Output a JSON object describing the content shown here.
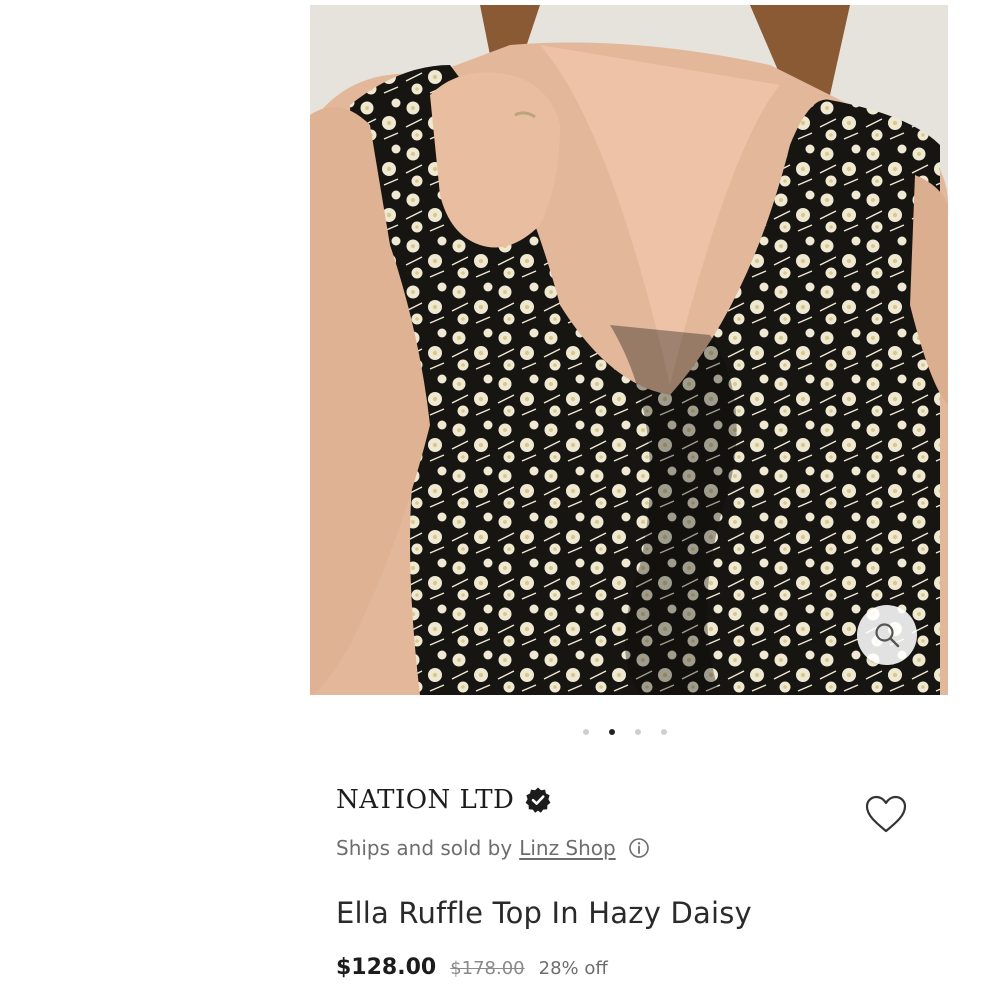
{
  "product": {
    "image_alt": "Ella Ruffle Top In Hazy Daisy",
    "carousel": {
      "total": 4,
      "active": 2
    },
    "brand": "NATION LTD",
    "seller_prefix": "Ships and sold by",
    "seller_name": "Linz Shop",
    "title": "Ella Ruffle Top In Hazy Daisy",
    "price": "$128.00",
    "original_price": "$178.00",
    "discount": "28% off"
  },
  "icons": {
    "zoom": "magnifier-icon",
    "verified": "verified-badge-icon",
    "favorite": "heart-icon",
    "info": "info-icon"
  },
  "colors": {
    "text_primary": "#1c1c1c",
    "text_secondary": "#6d6d6d",
    "dot_active": "#222222",
    "dot_inactive": "#cfcfcf"
  }
}
